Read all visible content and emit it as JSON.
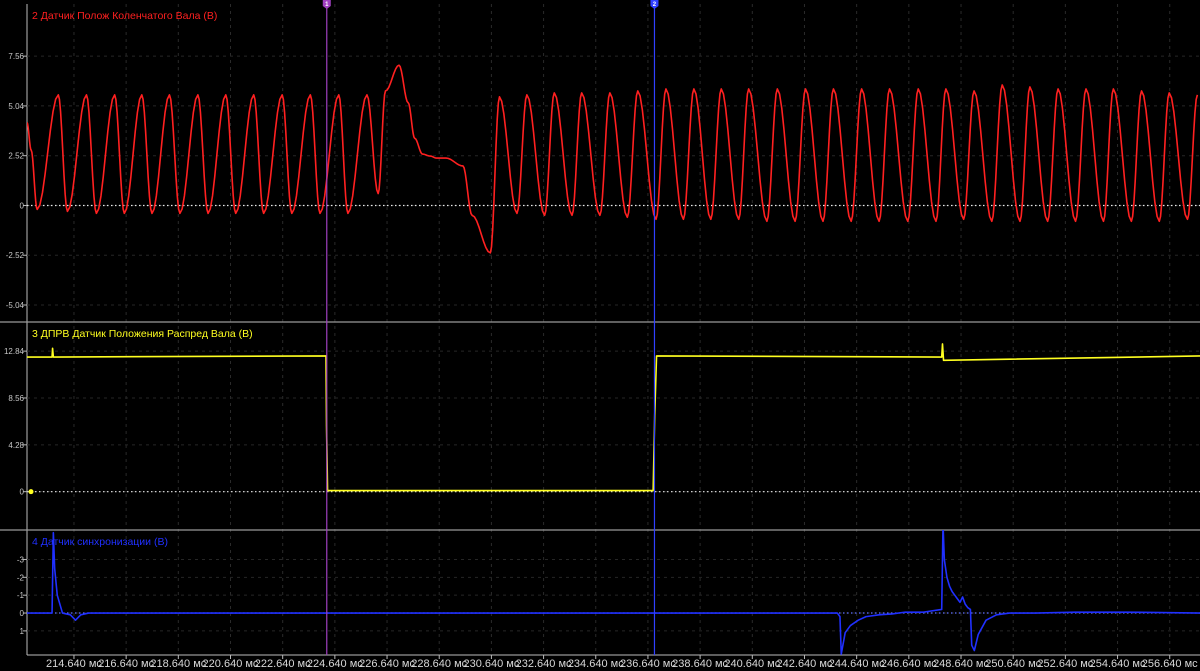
{
  "chart_data": {
    "type": "line",
    "x_unit": "мс",
    "x_range": [
      212.84,
      257.8
    ],
    "x_ticks": [
      "214.640 мс",
      "216.640 мс",
      "218.640 мс",
      "220.640 мс",
      "222.640 мс",
      "224.640 мс",
      "226.640 мс",
      "228.640 мс",
      "230.640 мс",
      "232.640 мс",
      "234.640 мс",
      "236.640 мс",
      "238.640 мс",
      "240.640 мс",
      "242.640 мс",
      "244.640 мс",
      "246.640 мс",
      "248.640 мс",
      "250.640 мс",
      "252.640 мс",
      "254.640 мс",
      "256.640 мс"
    ],
    "x_tick_values": [
      214.64,
      216.64,
      218.64,
      220.64,
      222.64,
      224.64,
      226.64,
      228.64,
      230.64,
      232.64,
      234.64,
      236.64,
      238.64,
      240.64,
      242.64,
      244.64,
      246.64,
      248.64,
      250.64,
      252.64,
      254.64,
      256.64
    ],
    "markers": [
      {
        "label": "1",
        "x": 224.33,
        "color": "#a040c0"
      },
      {
        "label": "2",
        "x": 236.89,
        "color": "#3040ff"
      }
    ],
    "channels": [
      {
        "name": "2 Датчик Полож Коленчатого Вала (В)",
        "color": "#ff2020",
        "ylim": [
          -5.9,
          10.2
        ],
        "yticks": [
          "7.56",
          "5.04",
          "2.52",
          "0",
          "-2.52",
          "-5.04"
        ],
        "ytick_values": [
          7.56,
          5.04,
          2.52,
          0,
          -2.52,
          -5.04
        ],
        "x": [
          212.84,
          213.0,
          213.23,
          214.04,
          214.39,
          215.12,
          215.5,
          216.2,
          216.57,
          217.24,
          217.63,
          218.3,
          218.7,
          219.39,
          219.78,
          220.46,
          220.84,
          221.53,
          221.91,
          222.62,
          222.99,
          223.7,
          224.07,
          224.79,
          225.14,
          225.87,
          226.3,
          226.58,
          227.1,
          227.45,
          227.7,
          228.0,
          228.3,
          228.53,
          228.9,
          229.55,
          229.9,
          230.6,
          230.95,
          231.62,
          232.0,
          232.68,
          233.05,
          233.73,
          234.1,
          234.8,
          235.18,
          235.85,
          236.25,
          236.95,
          237.33,
          238.0,
          238.4,
          239.05,
          239.45,
          240.12,
          240.5,
          241.2,
          241.6,
          242.28,
          242.68,
          243.35,
          243.75,
          244.43,
          244.83,
          245.5,
          245.9,
          246.6,
          247.0,
          247.68,
          248.06,
          248.74,
          249.14,
          249.82,
          250.22,
          250.9,
          251.28,
          251.96,
          252.36,
          253.03,
          253.43,
          254.1,
          254.48,
          255.17,
          255.56,
          256.24,
          256.62,
          257.32,
          257.7
        ],
        "y": [
          4.2,
          2.8,
          -0.2,
          5.6,
          -0.3,
          5.6,
          -0.4,
          5.6,
          -0.4,
          5.6,
          -0.4,
          5.6,
          -0.4,
          5.6,
          -0.4,
          5.6,
          -0.4,
          5.6,
          -0.4,
          5.6,
          -0.4,
          5.6,
          -0.4,
          5.6,
          -0.4,
          5.6,
          0.6,
          5.8,
          7.1,
          5.2,
          3.4,
          2.6,
          2.5,
          2.4,
          2.4,
          2.0,
          -0.5,
          -2.4,
          5.5,
          -0.4,
          5.6,
          -0.5,
          5.7,
          -0.5,
          5.7,
          -0.5,
          5.7,
          -0.6,
          5.8,
          -0.7,
          5.9,
          -0.7,
          5.9,
          -0.7,
          5.9,
          -0.7,
          5.9,
          -0.8,
          5.9,
          -0.8,
          5.9,
          -0.8,
          5.9,
          -0.8,
          5.9,
          -0.8,
          5.9,
          -0.8,
          5.9,
          -0.8,
          5.9,
          -0.7,
          5.8,
          -0.8,
          6.1,
          -0.8,
          6.0,
          -0.8,
          5.9,
          -0.8,
          5.9,
          -0.8,
          5.9,
          -0.8,
          5.8,
          -0.8,
          5.7,
          -0.7,
          5.6
        ]
      },
      {
        "name": "3 ДПРВ Датчик Положения Распред Вала (В)",
        "color": "#ffff20",
        "ylim": [
          -3.5,
          15.5
        ],
        "yticks": [
          "12.84",
          "8.56",
          "4.28",
          "0"
        ],
        "ytick_values": [
          12.84,
          8.56,
          4.28,
          0
        ],
        "x": [
          212.84,
          213.8,
          213.82,
          213.85,
          224.3,
          224.32,
          224.36,
          236.84,
          236.9,
          236.97,
          247.9,
          247.93,
          247.97,
          257.8
        ],
        "y": [
          12.3,
          12.3,
          13.1,
          12.3,
          12.4,
          6.0,
          0.1,
          0.1,
          7.0,
          12.4,
          12.3,
          13.5,
          12.0,
          12.4
        ]
      },
      {
        "name": "4 Датчик синхронизации (В)",
        "color": "#2030ff",
        "ylim": [
          2.35,
          -4.65
        ],
        "yticks": [
          "-3",
          "-2",
          "-1",
          "0",
          "1"
        ],
        "ytick_values": [
          -3,
          -2,
          -1,
          0,
          1
        ],
        "x": [
          212.84,
          213.8,
          213.85,
          213.9,
          214.0,
          214.2,
          214.5,
          214.7,
          214.9,
          215.2,
          215.6,
          243.9,
          244.0,
          244.05,
          244.2,
          244.4,
          244.7,
          245.0,
          245.5,
          246.0,
          246.5,
          247.2,
          247.9,
          247.95,
          248.0,
          248.1,
          248.2,
          248.3,
          248.4,
          248.5,
          248.6,
          248.7,
          248.8,
          248.9,
          249.0,
          249.05,
          249.15,
          249.3,
          249.6,
          250.0,
          250.5,
          251.5,
          253.0,
          255.0,
          257.8
        ],
        "y": [
          0,
          0,
          -4.5,
          -2.5,
          -1.0,
          0.0,
          0.1,
          0.4,
          0.1,
          0,
          0,
          0,
          0.2,
          2.3,
          1.1,
          0.7,
          0.4,
          0.2,
          0.1,
          0.05,
          -0.05,
          -0.05,
          -0.2,
          -5.0,
          -3.0,
          -2.0,
          -1.5,
          -1.2,
          -1.0,
          -0.8,
          -0.6,
          -0.9,
          -0.5,
          -0.3,
          -0.2,
          1.8,
          2.1,
          1.2,
          0.4,
          0.1,
          0,
          0,
          -0.05,
          -0.05,
          0
        ]
      }
    ]
  }
}
